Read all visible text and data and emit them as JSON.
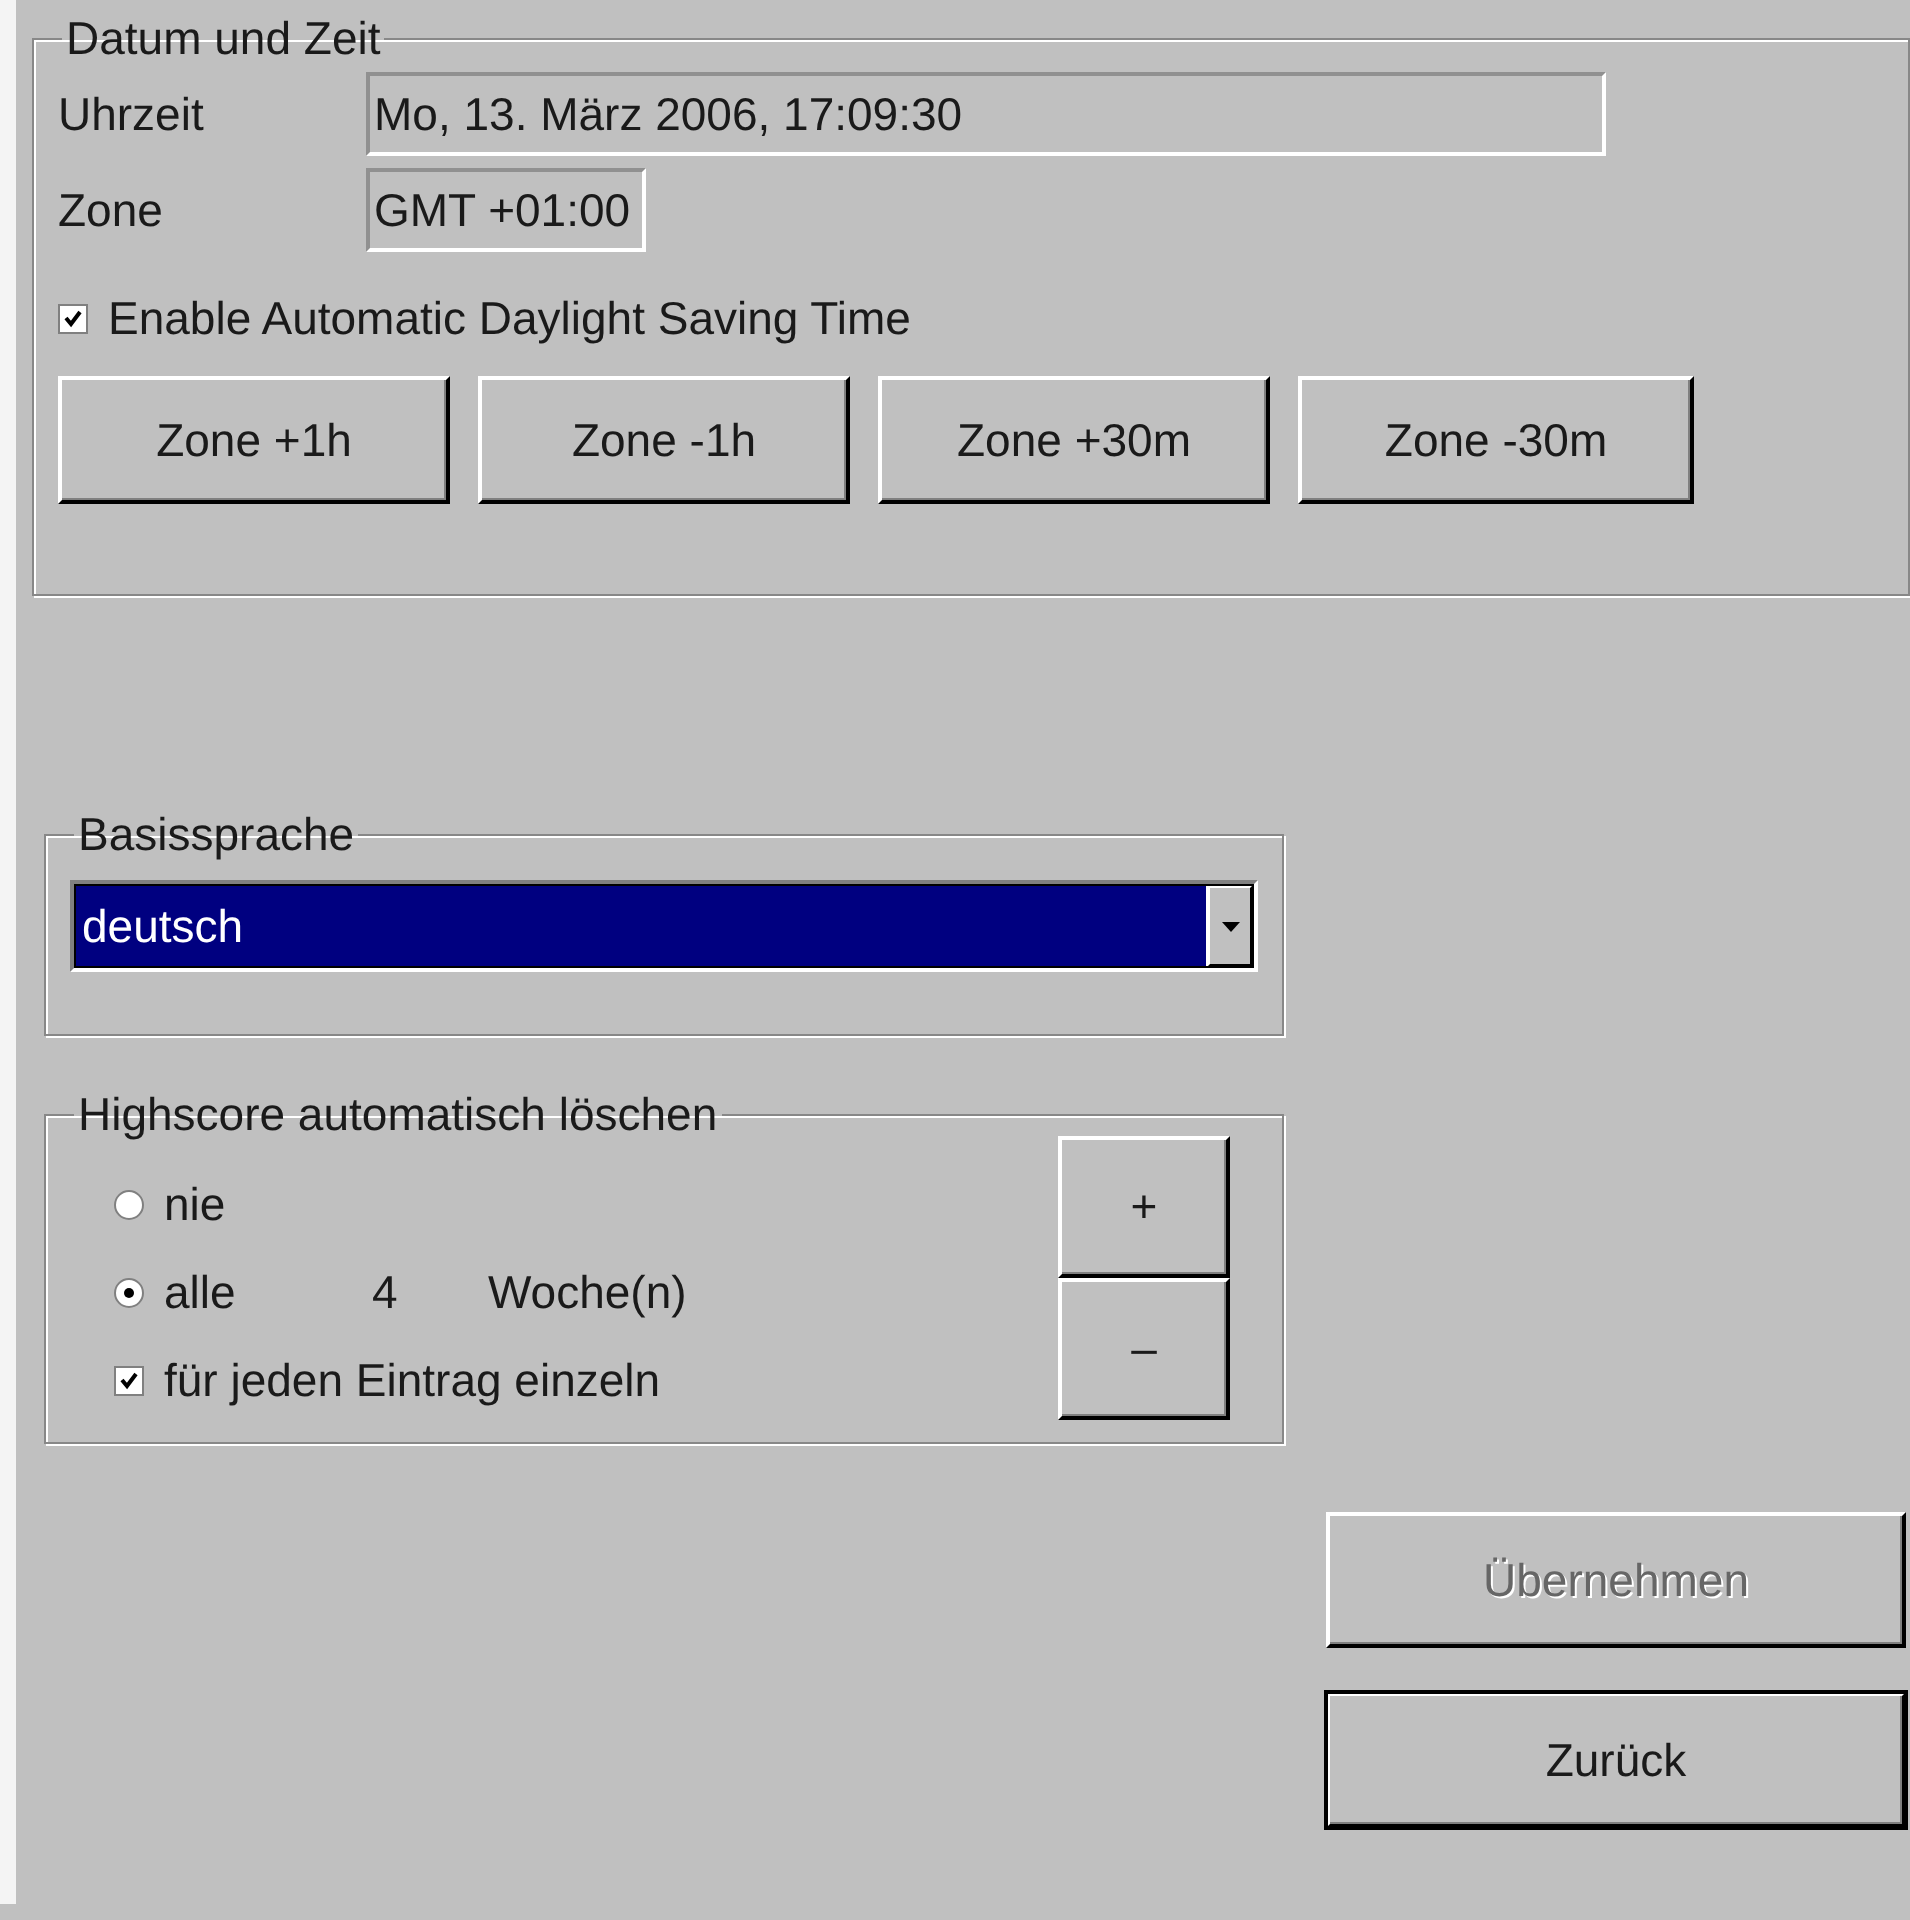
{
  "datetime_group": {
    "title": "Datum und Zeit",
    "fields": [
      {
        "label": "Uhrzeit",
        "value": "Mo, 13. März 2006, 17:09:30"
      },
      {
        "label": "Zone",
        "value": "GMT +01:00"
      }
    ],
    "dst_checkbox": {
      "label": "Enable Automatic Daylight Saving Time",
      "checked": true
    },
    "zone_buttons": [
      "Zone +1h",
      "Zone -1h",
      "Zone +30m",
      "Zone -30m"
    ]
  },
  "language_group": {
    "title": "Basissprache",
    "select": {
      "value": "deutsch"
    }
  },
  "highscore_group": {
    "title": "Highscore automatisch löschen",
    "options": [
      {
        "label": "nie",
        "selected": false
      },
      {
        "label": "alle",
        "selected": true
      }
    ],
    "interval_value": "4",
    "interval_unit": "Woche(n)",
    "per_entry_checkbox": {
      "label": "für jeden Eintrag einzeln",
      "checked": true
    },
    "stepper_buttons": [
      "+",
      "–"
    ]
  },
  "actions": [
    {
      "label": "Übernehmen",
      "disabled": true
    },
    {
      "label": "Zurück",
      "disabled": false
    }
  ]
}
